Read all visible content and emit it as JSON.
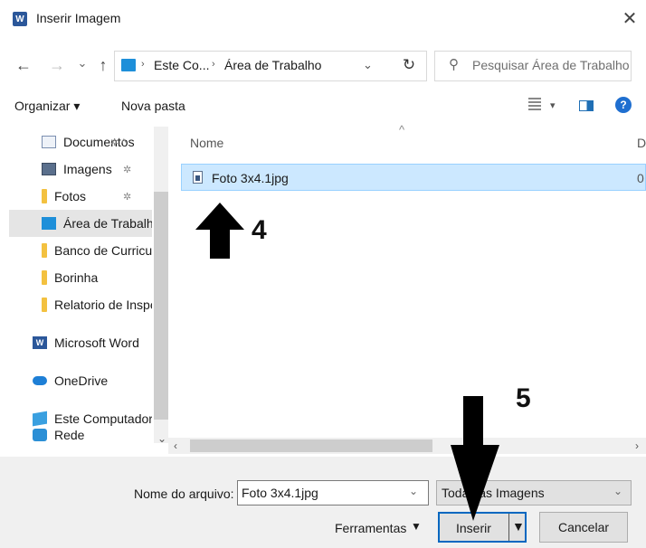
{
  "window": {
    "title": "Inserir Imagem",
    "app_icon_letter": "W",
    "close_glyph": "✕"
  },
  "nav": {
    "back": "←",
    "forward": "→",
    "recent": "⌄",
    "up": "↑"
  },
  "address": {
    "sep1": "›",
    "crumb1": "Este Co...",
    "sep2": "›",
    "crumb2": "Área de Trabalho",
    "dropdown": "⌄",
    "refresh": "↻"
  },
  "search": {
    "placeholder": "Pesquisar Área de Trabalho",
    "icon": "⚲"
  },
  "toolbar": {
    "organize": "Organizar ▾",
    "new_folder": "Nova pasta",
    "view_caret": "▾",
    "help": "?"
  },
  "sidebar": {
    "items": [
      {
        "label": "Documentos",
        "pin": "✲  ^"
      },
      {
        "label": "Imagens",
        "pin": "✲"
      },
      {
        "label": "Fotos",
        "pin": "✲"
      },
      {
        "label": "Área de Trabalho"
      },
      {
        "label": "Banco de Curriculo"
      },
      {
        "label": "Borinha"
      },
      {
        "label": "Relatorio de Inspeção"
      },
      {
        "label": "Microsoft Word",
        "word": "W"
      },
      {
        "label": "OneDrive"
      },
      {
        "label": "Este Computador"
      },
      {
        "label": "Rede",
        "chev": "⌄"
      }
    ]
  },
  "file_list": {
    "column_name": "Nome",
    "column_2": "D",
    "sort_caret": "^",
    "rows": [
      {
        "name": "Foto 3x4.1jpg",
        "col2": "0"
      }
    ]
  },
  "hscroll": {
    "left": "‹",
    "right": "›"
  },
  "footer": {
    "filename_label": "Nome do arquivo:",
    "filename_value": "Foto 3x4.1jpg",
    "filename_drop": "⌄",
    "filter_value": "Todas as Imagens",
    "filter_drop": "⌄",
    "tools_label": "Ferramentas",
    "tools_caret": "▼",
    "insert_label": "Inserir",
    "insert_caret": "▼",
    "cancel_label": "Cancelar"
  },
  "annotations": {
    "step_4": "4",
    "step_5": "5"
  }
}
